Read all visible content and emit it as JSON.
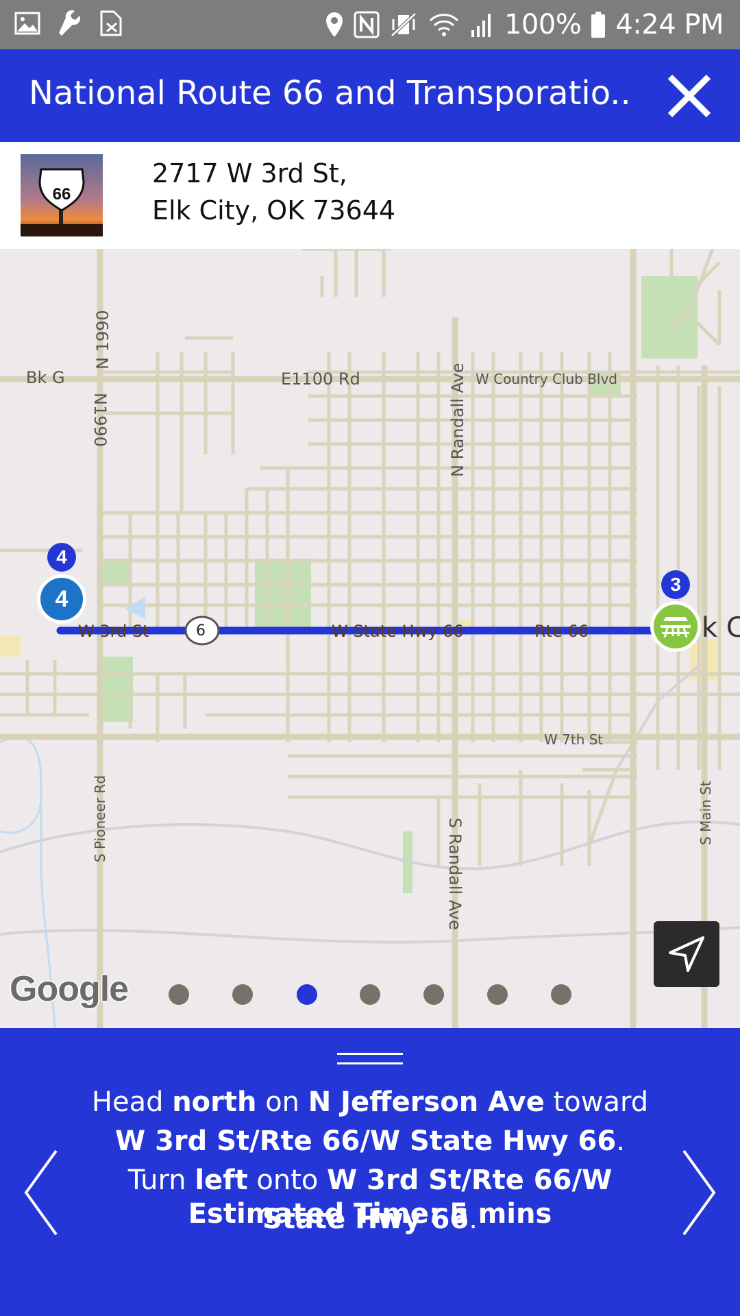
{
  "status_bar": {
    "battery": "100%",
    "time": "4:24 PM",
    "icons": [
      "image-icon",
      "wrench-icon",
      "sim-off-icon",
      "location-pin-icon",
      "nfc-icon",
      "vibrate-mute-icon",
      "wifi-icon",
      "signal-icon",
      "battery-icon"
    ]
  },
  "header": {
    "title": "National Route 66 and Transporatio..",
    "close_icon": "close-icon"
  },
  "address": {
    "line1": "2717 W 3rd St,",
    "line2": "Elk City, OK 73644",
    "thumbnail": "route-66-sign-image"
  },
  "map": {
    "labels": {
      "bk_g": "Bk G",
      "e1100": "E1100 Rd",
      "country_club": "W Country Club Blvd",
      "n1990_top": "N 1990",
      "n1990_bottom": "N1990",
      "n_randall": "N Randall Ave",
      "w_3rd": "W 3rd St",
      "shield": "6",
      "state_hwy": "W State Hwy 66",
      "rte66": "Rte 66",
      "elk_city": "k Ci",
      "w_7th": "W 7th St",
      "s_pioneer": "S Pioneer Rd",
      "s_randall": "S Randall Ave",
      "s_main": "S Main St"
    },
    "markers": {
      "start_badge": "4",
      "start_marker": "4",
      "end_badge": "3"
    },
    "google_logo": "Google",
    "locate_icon": "navigation-arrow-icon",
    "page_dots": {
      "count": 7,
      "active_index": 2
    },
    "colors": {
      "route": "#2536d6",
      "road": "#d8d2b8",
      "park": "#c5e0b4",
      "background": "#eeeaeb"
    }
  },
  "directions": {
    "parts": {
      "p1": "Head ",
      "b1": "north",
      "p2": " on ",
      "b2": "N Jefferson Ave",
      "p3": " toward ",
      "b3": "W 3rd St/Rte 66/W State Hwy 66",
      "p4": ". Turn ",
      "b4": "left",
      "p5": " onto ",
      "b5": "W 3rd St/Rte 66/W State Hwy 66",
      "p6": "."
    },
    "eta": "Estimated Time: 5 mins",
    "prev_icon": "chevron-left-icon",
    "next_icon": "chevron-right-icon"
  },
  "theme": {
    "primary": "#2536d6",
    "status_bar": "#7d7d7d"
  }
}
